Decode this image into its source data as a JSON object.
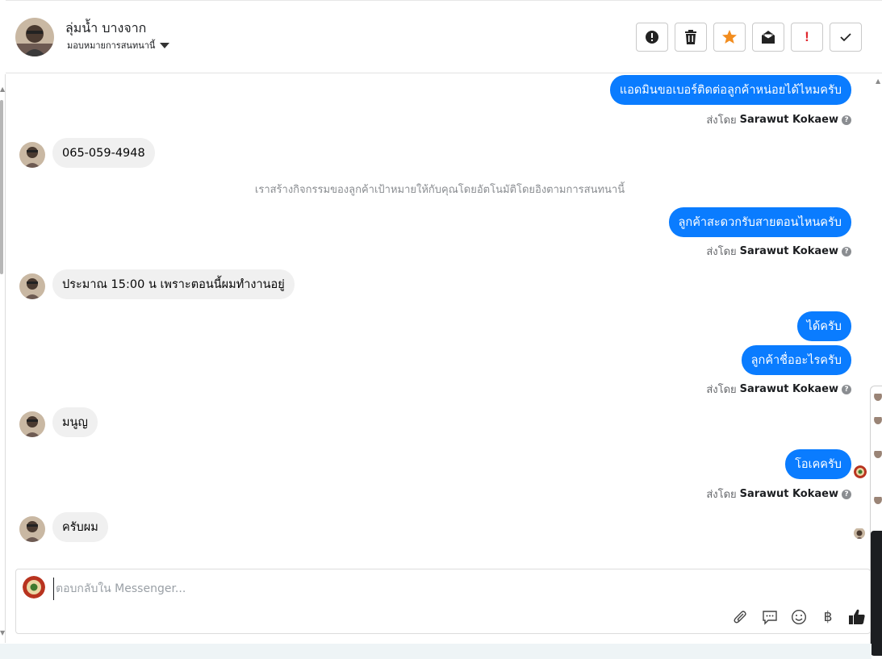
{
  "header": {
    "contact_name": "ลุ่มน้ำ บางจาก",
    "assign_label": "มอบหมายการสนทนานี้",
    "toolbar": [
      {
        "name": "mark-spam-button",
        "icon": "alert-circle-icon"
      },
      {
        "name": "delete-button",
        "icon": "trash-icon"
      },
      {
        "name": "star-button",
        "icon": "star-icon"
      },
      {
        "name": "mark-unread-button",
        "icon": "envelope-open-icon"
      },
      {
        "name": "follow-up-button",
        "icon": "exclamation-icon"
      },
      {
        "name": "mark-done-button",
        "icon": "check-icon"
      }
    ]
  },
  "messages": {
    "m1": "แอดมินขอเบอร์ติดต่อลูกค้าหน่อยได้ไหมครับ",
    "m2": "065-059-4948",
    "system_note": "เราสร้างกิจกรรมของลูกค้าเป้าหมายให้กับคุณโดยอัตโนมัติโดยอิงตามการสนทนานี้",
    "m3": "ลูกค้าสะดวกรับสายตอนไหนครับ",
    "m4": "ประมาณ 15:00 น เพราะตอนนี้ผมทำงานอยู่",
    "m5": "ได้ครับ",
    "m6": "ลูกค้าชื่ออะไรครับ",
    "m7": "มนูญ",
    "m8": "โอเคครับ",
    "m9": "ครับผม",
    "sent_by_prefix": "ส่งโดย",
    "sender_name": "Sarawut Kokaew"
  },
  "composer": {
    "placeholder": "ตอบกลับใน Messenger...",
    "icons": [
      "paperclip-icon",
      "chat-reply-icon",
      "smiley-icon",
      "baht-icon",
      "thumbs-up-icon"
    ],
    "baht_symbol": "฿"
  },
  "colors": {
    "outgoing_bubble": "#0a7cff",
    "incoming_bubble": "#f0f0f0",
    "star": "#f28d1f",
    "follow_up": "#e0282e"
  }
}
